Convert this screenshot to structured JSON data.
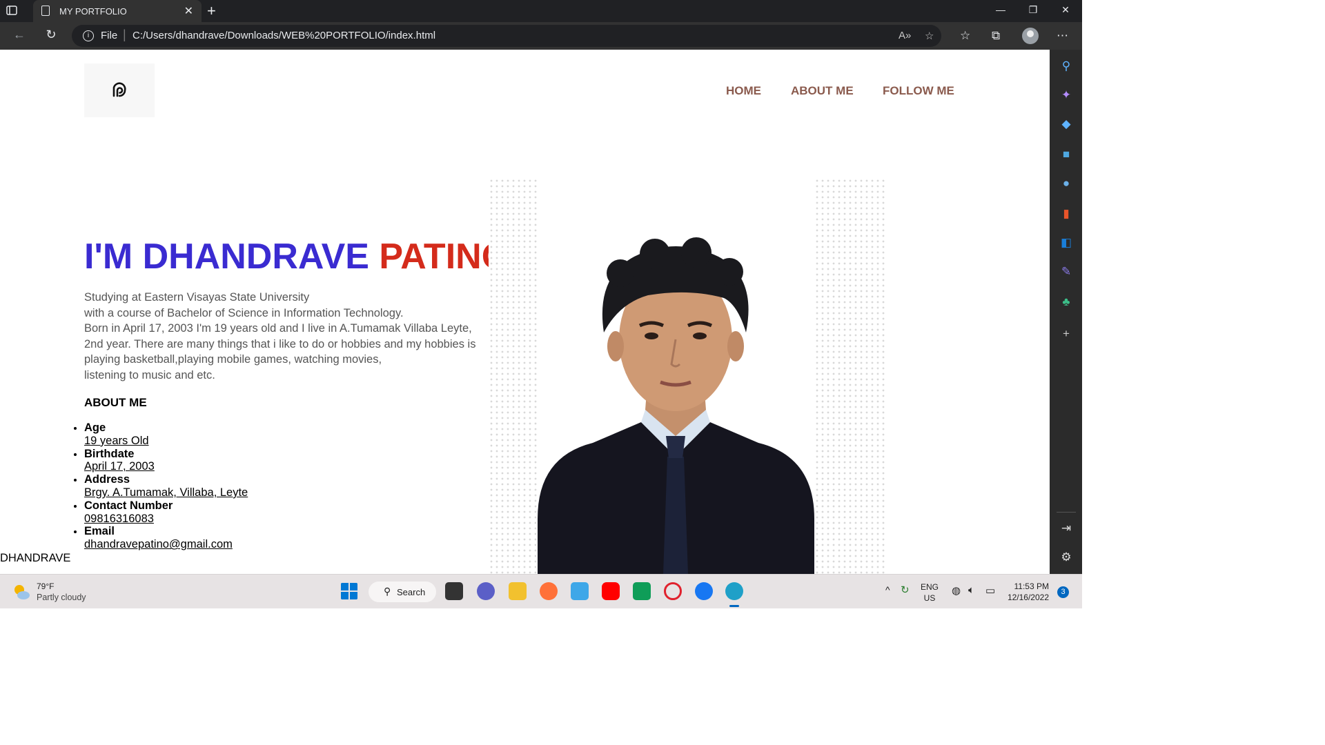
{
  "browser": {
    "tab_title": "MY PORTFOLIO",
    "omnibox_scheme": "File",
    "url": "C:/Users/dhandrave/Downloads/WEB%20PORTFOLIO/index.html"
  },
  "nav": {
    "items": [
      {
        "label": "HOME"
      },
      {
        "label": "ABOUT ME"
      },
      {
        "label": "FOLLOW ME"
      }
    ]
  },
  "hero": {
    "title_first": "I'M DHANDRAVE",
    "title_last": "PATINO",
    "bio": [
      "Studying at Eastern Visayas State University",
      "with a course of Bachelor of Science in Information Technology.",
      "Born in April 17, 2003 I'm 19 years old and I live in A.Tumamak Villaba Leyte,",
      "2nd year. There are many things that i like to do or hobbies and my hobbies is",
      "playing basketball,playing mobile games, watching movies,",
      "listening to music and etc."
    ]
  },
  "about": {
    "heading": "ABOUT ME",
    "facts": [
      {
        "label": "Age",
        "value": "19 years Old"
      },
      {
        "label": "Birthdate",
        "value": "April 17, 2003"
      },
      {
        "label": "Address",
        "value": "Brgy. A.Tumamak, Villaba, Leyte"
      },
      {
        "label": "Contact Number",
        "value": "09816316083"
      },
      {
        "label": "Email",
        "value": "dhandravepatino@gmail.com"
      }
    ]
  },
  "footer": {
    "name": "DHANDRAVE"
  },
  "taskbar": {
    "weather_temp": "79°F",
    "weather_desc": "Partly cloudy",
    "search_label": "Search",
    "lang_top": "ENG",
    "lang_bottom": "US",
    "time": "11:53 PM",
    "date": "12/16/2022",
    "notification_count": "3"
  },
  "colors": {
    "accent_blue": "#3a2bd1",
    "accent_red": "#d42b1b",
    "nav_brown": "#8a5a4d"
  }
}
